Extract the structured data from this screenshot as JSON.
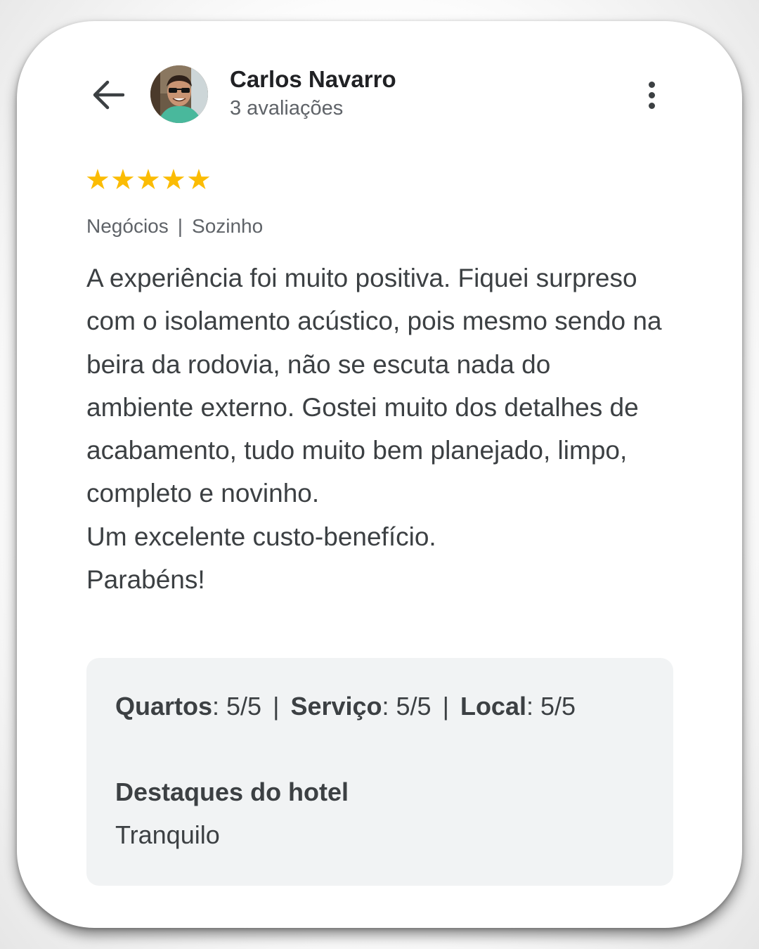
{
  "header": {
    "back_icon": "arrow-left-icon",
    "reviewer_name": "Carlos Navarro",
    "review_count": "3 avaliações",
    "menu_icon": "more-vert-icon"
  },
  "rating": {
    "stars": 5,
    "max": 5,
    "color": "#fbbc04"
  },
  "tags": {
    "trip_type": "Negócios",
    "separator": "|",
    "companions": "Sozinho"
  },
  "review": {
    "paragraphs": [
      "A experiência foi muito positiva. Fiquei surpreso com o isolamento acústico, pois mesmo sendo na beira da rodovia, não se escuta nada do ambiente externo. Gostei muito dos detalhes de acabamento, tudo muito bem planejado, limpo, completo e novinho.",
      "Um excelente custo-benefício.",
      "Parabéns!"
    ]
  },
  "details": {
    "ratings": [
      {
        "label": "Quartos",
        "value": ": 5/5"
      },
      {
        "label": "Serviço",
        "value": ": 5/5"
      },
      {
        "label": "Local",
        "value": ": 5/5"
      }
    ],
    "separator": "|",
    "highlights_title": "Destaques do hotel",
    "highlights_value": "Tranquilo"
  }
}
